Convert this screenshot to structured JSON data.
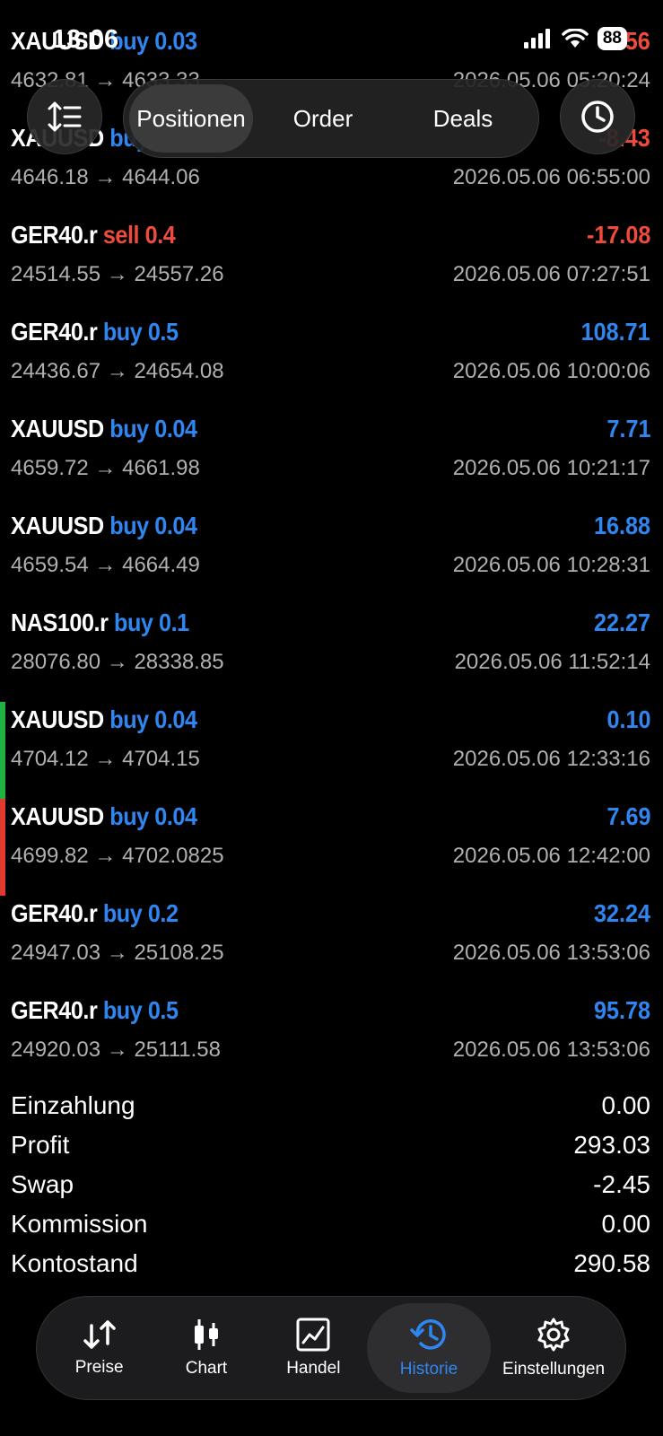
{
  "status": {
    "time": "13:06",
    "battery": "88"
  },
  "segments": {
    "positions": "Positionen",
    "orders": "Order",
    "deals": "Deals"
  },
  "icons": {
    "sort": "sort-icon",
    "clock": "clock-icon"
  },
  "trades": [
    {
      "symbol": "XAUUSD",
      "dir": "buy 0.03",
      "type": "buy",
      "prices": "4632.81 → 4633.33",
      "profit": "-1.56",
      "sign": "neg",
      "time": "2026.05.06 05:20:24",
      "marker": ""
    },
    {
      "symbol": "XAUUSD",
      "dir": "buy 0.04",
      "type": "buy",
      "prices": "4646.18 → 4644.06",
      "profit": "-8.43",
      "sign": "neg",
      "time": "2026.05.06 06:55:00",
      "marker": ""
    },
    {
      "symbol": "GER40.r",
      "dir": "sell 0.4",
      "type": "sell",
      "prices": "24514.55 → 24557.26",
      "profit": "-17.08",
      "sign": "neg",
      "time": "2026.05.06 07:27:51",
      "marker": ""
    },
    {
      "symbol": "GER40.r",
      "dir": "buy 0.5",
      "type": "buy",
      "prices": "24436.67 → 24654.08",
      "profit": "108.71",
      "sign": "pos",
      "time": "2026.05.06 10:00:06",
      "marker": ""
    },
    {
      "symbol": "XAUUSD",
      "dir": "buy 0.04",
      "type": "buy",
      "prices": "4659.72 → 4661.98",
      "profit": "7.71",
      "sign": "pos",
      "time": "2026.05.06 10:21:17",
      "marker": ""
    },
    {
      "symbol": "XAUUSD",
      "dir": "buy 0.04",
      "type": "buy",
      "prices": "4659.54 → 4664.49",
      "profit": "16.88",
      "sign": "pos",
      "time": "2026.05.06 10:28:31",
      "marker": ""
    },
    {
      "symbol": "NAS100.r",
      "dir": "buy 0.1",
      "type": "buy",
      "prices": "28076.80 → 28338.85",
      "profit": "22.27",
      "sign": "pos",
      "time": "2026.05.06 11:52:14",
      "marker": ""
    },
    {
      "symbol": "XAUUSD",
      "dir": "buy 0.04",
      "type": "buy",
      "prices": "4704.12 → 4704.15",
      "profit": "0.10",
      "sign": "pos",
      "time": "2026.05.06 12:33:16",
      "marker": "#1fb141"
    },
    {
      "symbol": "XAUUSD",
      "dir": "buy 0.04",
      "type": "buy",
      "prices": "4699.82 → 4702.0825",
      "profit": "7.69",
      "sign": "pos",
      "time": "2026.05.06 12:42:00",
      "marker": "#e23a2e"
    },
    {
      "symbol": "GER40.r",
      "dir": "buy 0.2",
      "type": "buy",
      "prices": "24947.03 → 25108.25",
      "profit": "32.24",
      "sign": "pos",
      "time": "2026.05.06 13:53:06",
      "marker": ""
    },
    {
      "symbol": "GER40.r",
      "dir": "buy 0.5",
      "type": "buy",
      "prices": "24920.03 → 25111.58",
      "profit": "95.78",
      "sign": "pos",
      "time": "2026.05.06 13:53:06",
      "marker": ""
    }
  ],
  "summary": [
    {
      "label": "Einzahlung",
      "value": "0.00"
    },
    {
      "label": "Profit",
      "value": "293.03"
    },
    {
      "label": "Swap",
      "value": "-2.45"
    },
    {
      "label": "Kommission",
      "value": "0.00"
    },
    {
      "label": "Kontostand",
      "value": "290.58"
    }
  ],
  "tabs": [
    {
      "label": "Preise",
      "icon": "quotes-icon"
    },
    {
      "label": "Chart",
      "icon": "candlestick-icon"
    },
    {
      "label": "Handel",
      "icon": "trade-icon"
    },
    {
      "label": "Historie",
      "icon": "history-icon"
    },
    {
      "label": "Einstellungen",
      "icon": "gear-icon"
    }
  ],
  "colors": {
    "buy": "#2f86f0",
    "sell": "#ee4b3c",
    "background": "#000000"
  }
}
